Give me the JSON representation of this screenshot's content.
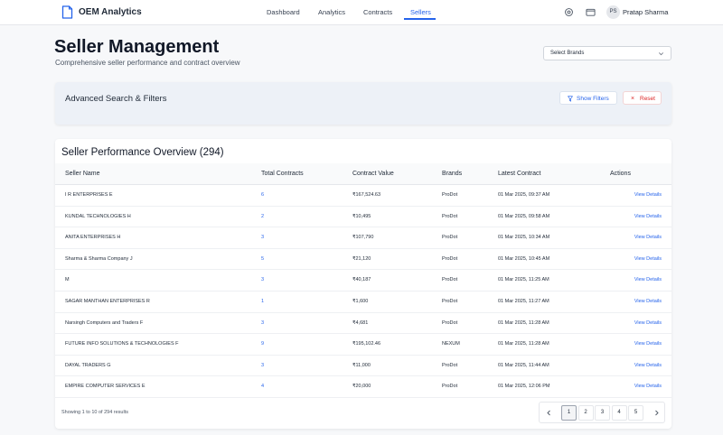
{
  "app": {
    "name": "OEM Analytics"
  },
  "nav": {
    "items": [
      {
        "label": "Dashboard",
        "active": false
      },
      {
        "label": "Analytics",
        "active": false
      },
      {
        "label": "Contracts",
        "active": false
      },
      {
        "label": "Sellers",
        "active": true
      }
    ]
  },
  "user": {
    "initials": "PS",
    "name": "Pratap Sharma"
  },
  "header": {
    "title": "Seller Management",
    "subtitle": "Comprehensive seller performance and contract overview"
  },
  "brand_select": {
    "label": "Select Brands"
  },
  "filters": {
    "title": "Advanced Search & Filters",
    "show_label": "Show Filters",
    "reset_label": "Reset",
    "reset_icon": "×"
  },
  "table": {
    "title": "Seller Performance Overview (294)",
    "columns": [
      "Seller Name",
      "Total Contracts",
      "Contract Value",
      "Brands",
      "Latest Contract",
      "Actions"
    ],
    "rows": [
      {
        "name": "I R ENTERPRISES E",
        "contracts": "6",
        "value": "₹167,524.63",
        "brand": "ProDot",
        "latest": "01 Mar 2025, 09:37 AM",
        "action": "View Details"
      },
      {
        "name": "KUNDAL TECHNOLOGIES H",
        "contracts": "2",
        "value": "₹10,495",
        "brand": "ProDot",
        "latest": "01 Mar 2025, 09:58 AM",
        "action": "View Details"
      },
      {
        "name": "ANITA ENTERPRISES H",
        "contracts": "3",
        "value": "₹107,790",
        "brand": "ProDot",
        "latest": "01 Mar 2025, 10:34 AM",
        "action": "View Details"
      },
      {
        "name": "Sharma & Sharma Company J",
        "contracts": "5",
        "value": "₹21,120",
        "brand": "ProDot",
        "latest": "01 Mar 2025, 10:45 AM",
        "action": "View Details"
      },
      {
        "name": "M",
        "contracts": "3",
        "value": "₹40,187",
        "brand": "ProDot",
        "latest": "01 Mar 2025, 11:25 AM",
        "action": "View Details"
      },
      {
        "name": "SAGAR MANTHAN ENTERPRISES R",
        "contracts": "1",
        "value": "₹1,600",
        "brand": "ProDot",
        "latest": "01 Mar 2025, 11:27 AM",
        "action": "View Details"
      },
      {
        "name": "Narsingh Computers and Traders F",
        "contracts": "3",
        "value": "₹4,681",
        "brand": "ProDot",
        "latest": "01 Mar 2025, 11:28 AM",
        "action": "View Details"
      },
      {
        "name": "FUTURE INFO SOLUTIONS & TECHNOLOGIES F",
        "contracts": "9",
        "value": "₹195,102.46",
        "brand": "NEXUM",
        "latest": "01 Mar 2025, 11:28 AM",
        "action": "View Details"
      },
      {
        "name": "DAYAL TRADERS G",
        "contracts": "3",
        "value": "₹11,000",
        "brand": "ProDot",
        "latest": "01 Mar 2025, 11:44 AM",
        "action": "View Details"
      },
      {
        "name": "EMPIRE COMPUTER SERVICES E",
        "contracts": "4",
        "value": "₹20,000",
        "brand": "ProDot",
        "latest": "01 Mar 2025, 12:06 PM",
        "action": "View Details"
      }
    ]
  },
  "pagination": {
    "summary": "Showing 1 to 10 of 294 results",
    "pages": [
      "1",
      "2",
      "3",
      "4",
      "5"
    ],
    "current": "1"
  },
  "colors": {
    "accent": "#2563eb",
    "danger": "#dc2626",
    "filter_bg": "#edf1f7"
  },
  "icons": [
    "document-icon",
    "gear-icon",
    "folder-icon",
    "filter-icon",
    "close-icon",
    "chevron-down-icon",
    "chevron-left-icon",
    "chevron-right-icon"
  ]
}
